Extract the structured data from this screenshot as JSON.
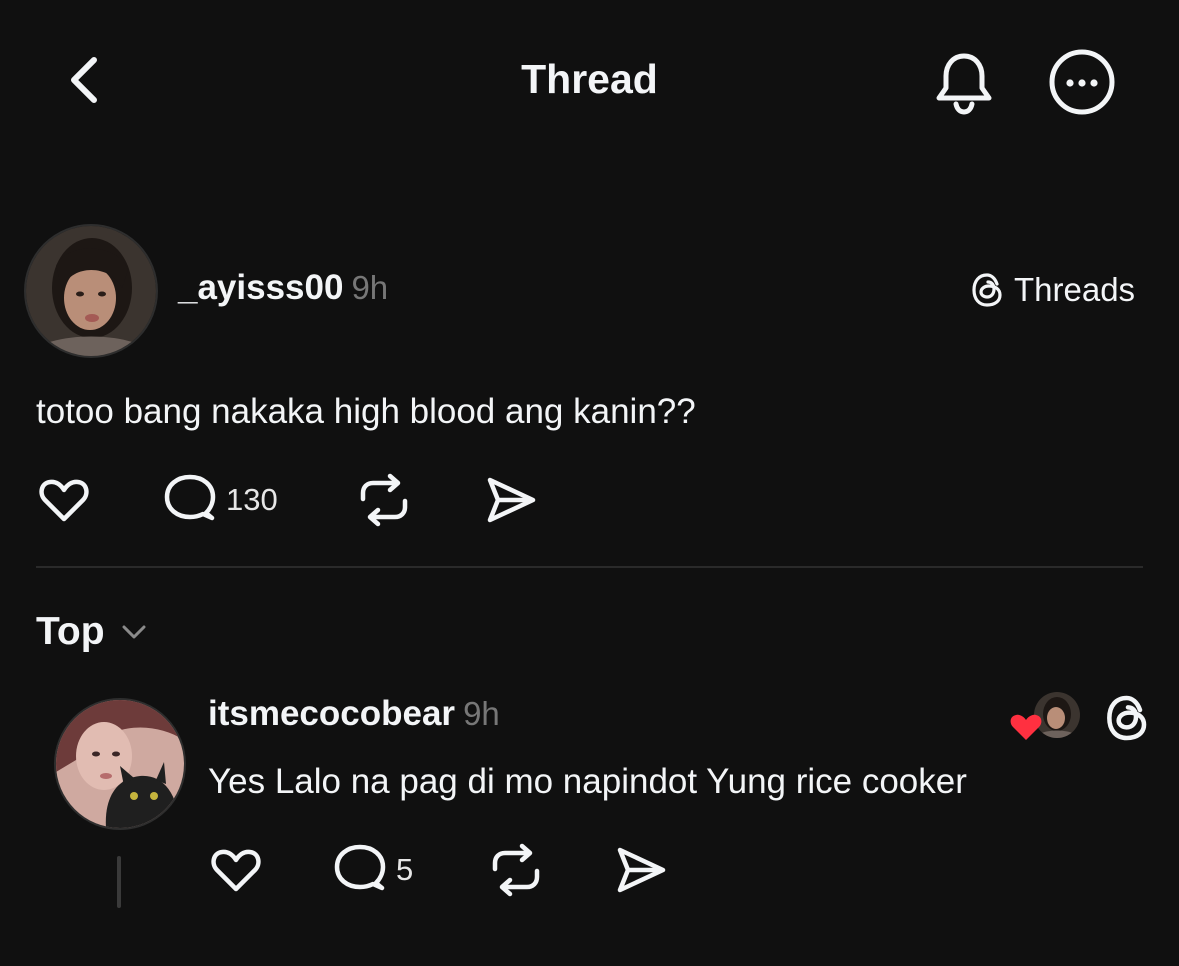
{
  "header": {
    "title": "Thread",
    "back_icon": "chevron-left-icon",
    "notify_icon": "bell-icon",
    "more_icon": "more-circle-icon"
  },
  "post": {
    "username": "_ayisss00",
    "time": "9h",
    "source_label": "Threads",
    "text": "totoo bang nakaka high blood ang kanin??",
    "reply_count": "130"
  },
  "sort": {
    "label": "Top"
  },
  "reply": {
    "username": "itsmecocobear",
    "time": "9h",
    "text": "Yes Lalo na pag di mo napindot Yung rice cooker",
    "reply_count": "5"
  },
  "colors": {
    "background": "#101010",
    "text": "#f3f5f7",
    "muted": "#777777",
    "heart_red": "#ff3040"
  }
}
